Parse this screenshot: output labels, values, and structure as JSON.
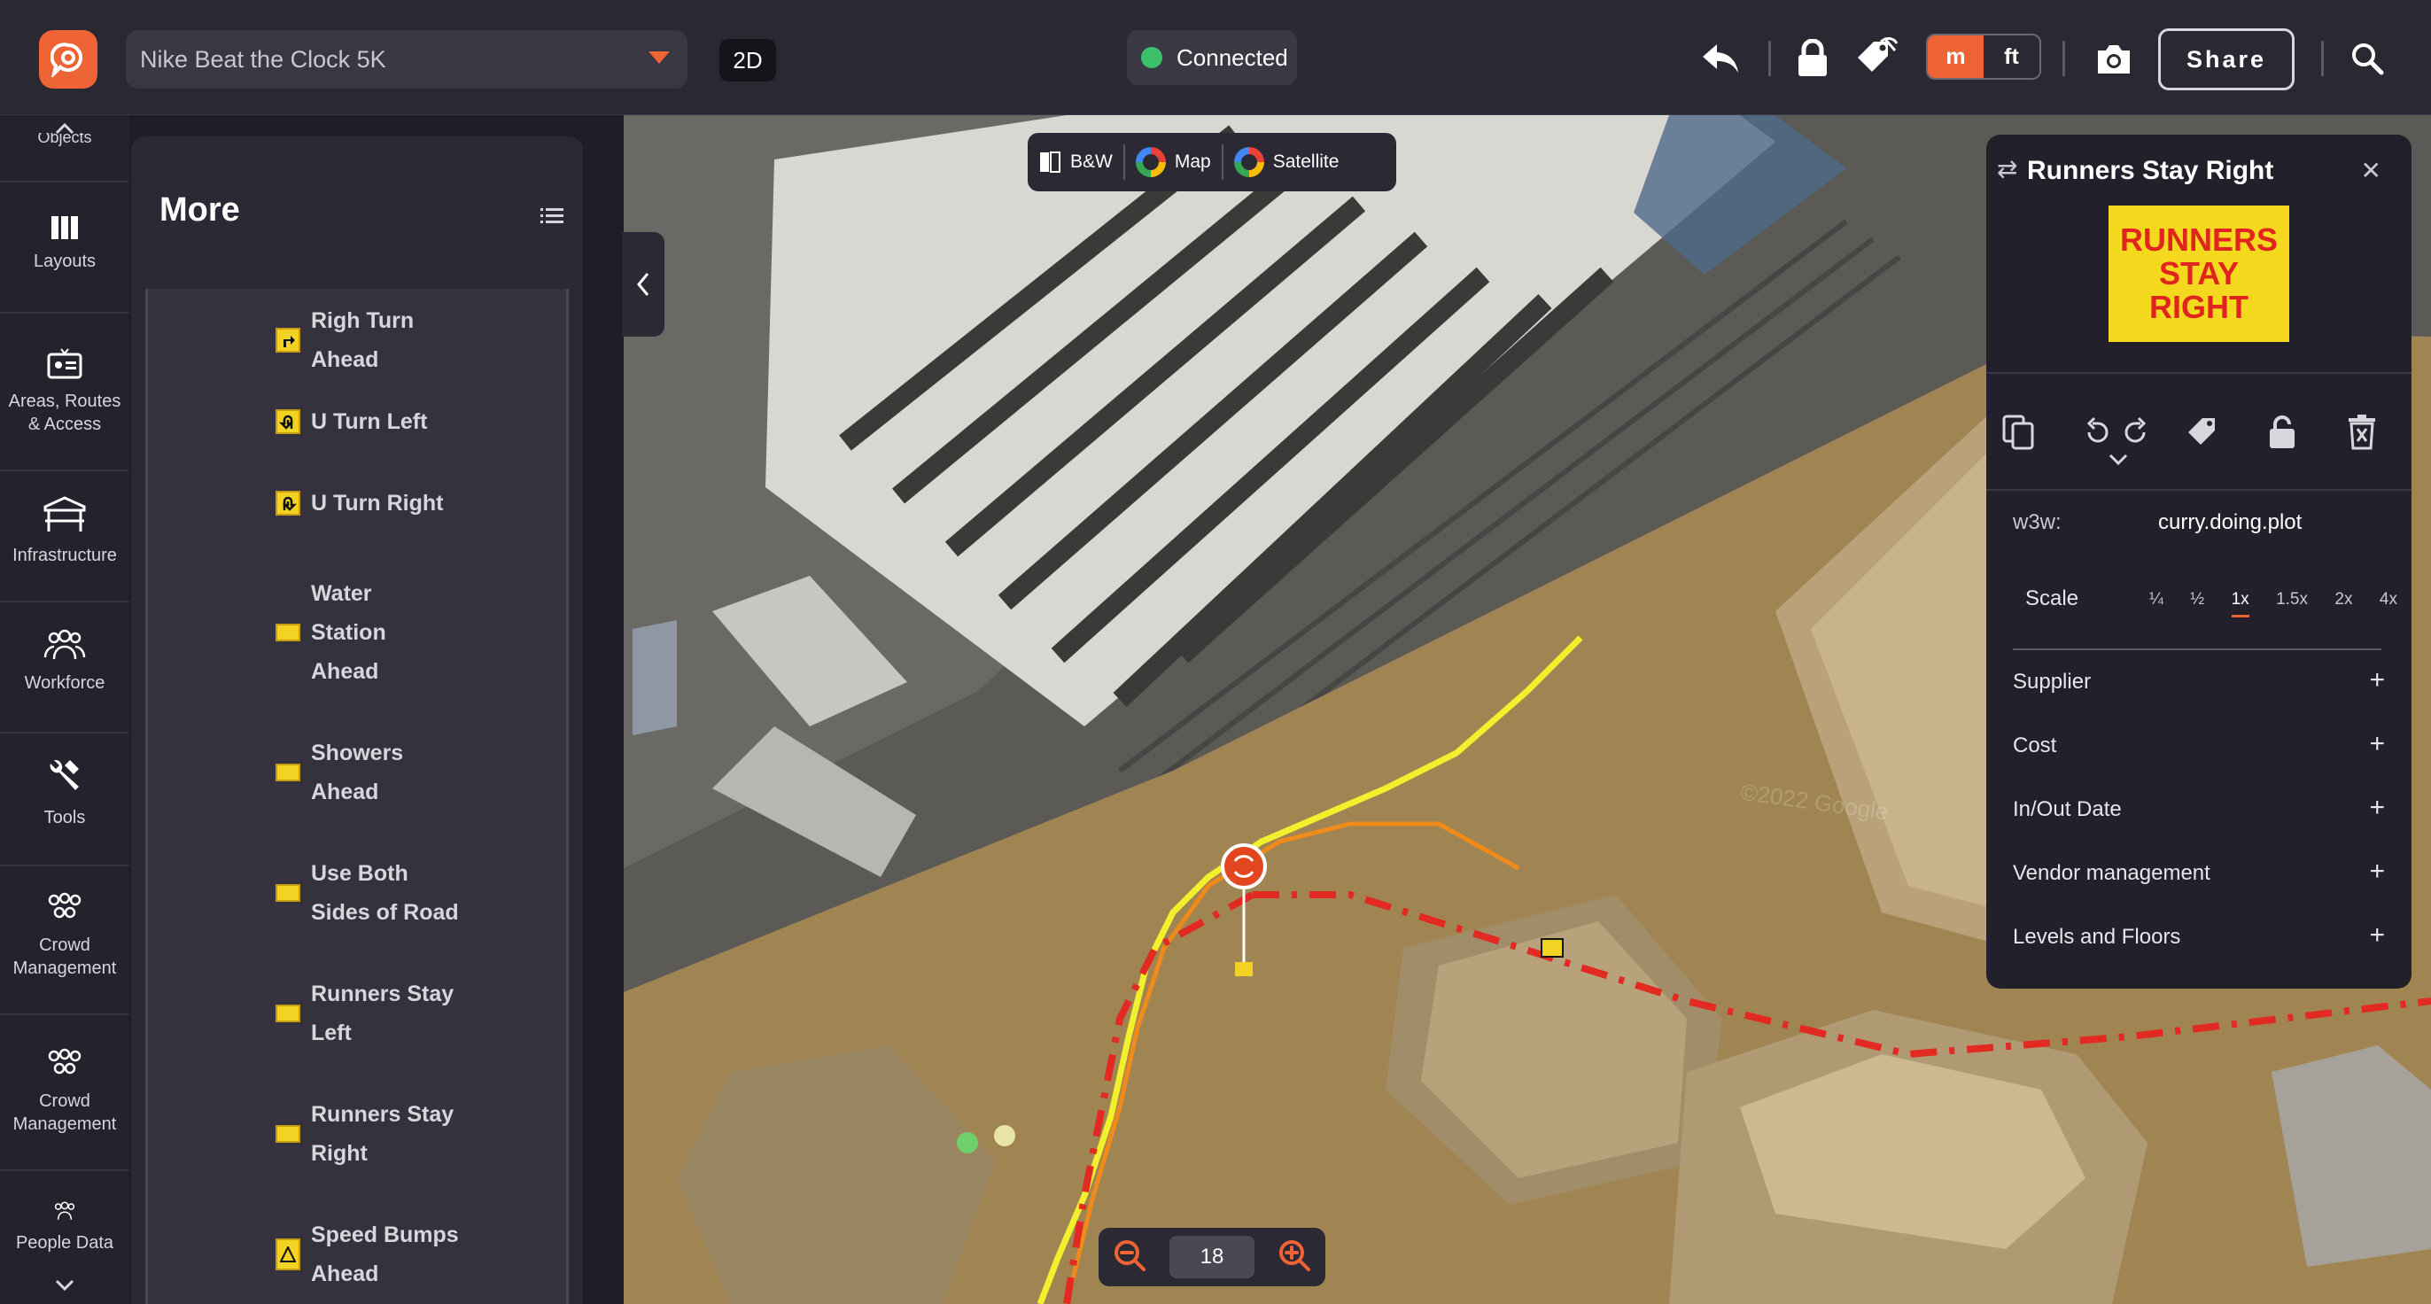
{
  "topbar": {
    "event_name": "Nike Beat the Clock 5K",
    "mode_2d": "2D",
    "status": "Connected",
    "status_color": "#3cc06a",
    "unit_m": "m",
    "unit_ft": "ft",
    "unit_selected": "m",
    "share_label": "Share",
    "accent": "#ef6435",
    "icons": [
      "undo-icon",
      "lock-icon",
      "tag-hide-icon",
      "camera-icon",
      "search-icon"
    ]
  },
  "rail": {
    "top_label": "Objects",
    "items": [
      {
        "label": "Layouts",
        "icon": "columns-icon"
      },
      {
        "label": "Areas, Routes & Access",
        "icon": "id-card-icon"
      },
      {
        "label": "Infrastructure",
        "icon": "stage-icon"
      },
      {
        "label": "Workforce",
        "icon": "people-icon"
      },
      {
        "label": "Tools",
        "icon": "tools-icon"
      },
      {
        "label": "Crowd Management",
        "icon": "crowd-icon"
      },
      {
        "label": "Crowd Management",
        "icon": "crowd-icon"
      },
      {
        "label": "People Data",
        "icon": "people-icon"
      }
    ]
  },
  "more_panel": {
    "title": "More",
    "items": [
      {
        "line1": "Righ Turn",
        "line2": "Ahead",
        "line3": ""
      },
      {
        "line1": "U Turn Left",
        "line2": "",
        "line3": ""
      },
      {
        "line1": "U Turn Right",
        "line2": "",
        "line3": ""
      },
      {
        "line1": "Water",
        "line2": "Station",
        "line3": "Ahead"
      },
      {
        "line1": "Showers",
        "line2": "Ahead",
        "line3": ""
      },
      {
        "line1": "Use Both",
        "line2": "Sides of Road",
        "line3": ""
      },
      {
        "line1": "Runners Stay",
        "line2": "Left",
        "line3": ""
      },
      {
        "line1": "Runners Stay",
        "line2": "Right",
        "line3": ""
      },
      {
        "line1": "Speed Bumps",
        "line2": "Ahead",
        "line3": ""
      }
    ]
  },
  "map": {
    "layers": [
      "B&W",
      "Map",
      "Satellite"
    ],
    "zoom": "18",
    "watermark": "©2022 Google"
  },
  "detail": {
    "title": "Runners Stay Right",
    "sign_lines": [
      "RUNNERS",
      "STAY",
      "RIGHT"
    ],
    "sign_bg": "#f4d91f",
    "sign_fg": "#e0251f",
    "w3w_label": "w3w:",
    "w3w_value": "curry.doing.plot",
    "scale_label": "Scale",
    "scales": [
      "¼",
      "½",
      "1x",
      "1.5x",
      "2x",
      "4x"
    ],
    "scale_selected": "1x",
    "sections": [
      "Supplier",
      "Cost",
      "In/Out Date",
      "Vendor management",
      "Levels and Floors"
    ]
  }
}
